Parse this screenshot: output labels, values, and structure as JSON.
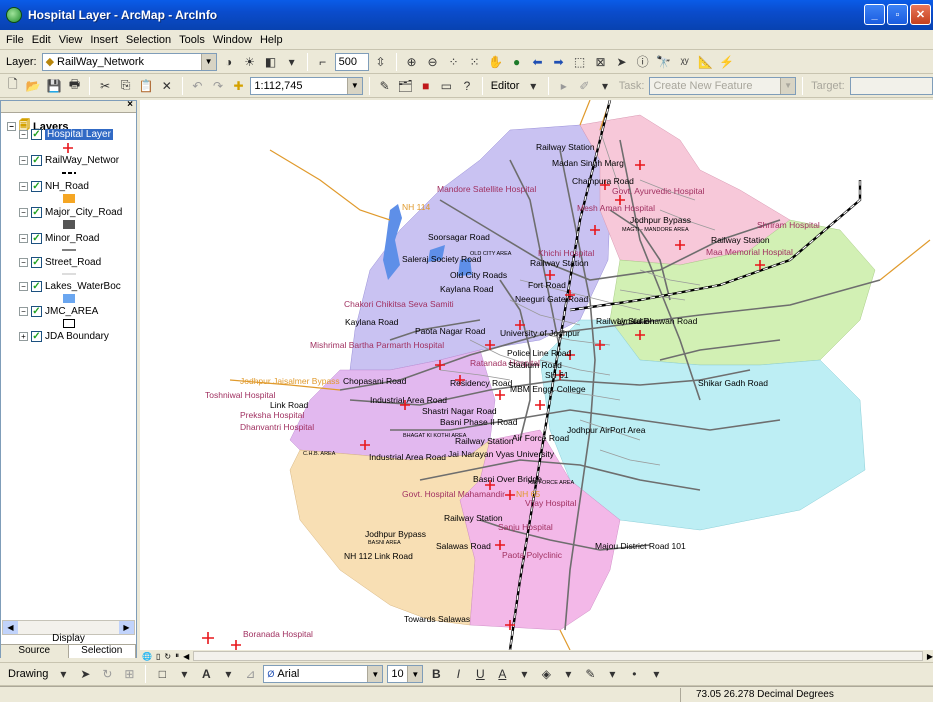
{
  "window": {
    "title": "Hospital Layer - ArcMap - ArcInfo"
  },
  "menu": [
    "File",
    "Edit",
    "View",
    "Insert",
    "Selection",
    "Tools",
    "Window",
    "Help"
  ],
  "toolbar1": {
    "layer_label": "Layer:",
    "layer_value": "RailWay_Network",
    "buffer_value": "500"
  },
  "toolbar2": {
    "scale_value": "1:112,745",
    "editor_label": "Editor",
    "task_label": "Task:",
    "task_value": "Create New Feature",
    "target_label": "Target:"
  },
  "toc": {
    "root_label": "Layers",
    "layers": [
      {
        "name": "Hospital Layer",
        "checked": true,
        "selected": true
      },
      {
        "name": "RailWay_Networ",
        "checked": true
      },
      {
        "name": "NH_Road",
        "checked": true
      },
      {
        "name": "Major_City_Road",
        "checked": true
      },
      {
        "name": "Minor_Road",
        "checked": true
      },
      {
        "name": "Street_Road",
        "checked": true
      },
      {
        "name": "Lakes_WaterBoc",
        "checked": true
      },
      {
        "name": "JMC_AREA",
        "checked": true
      },
      {
        "name": "JDA Boundary",
        "checked": true
      }
    ],
    "display_label": "Display",
    "tabs": [
      "Source",
      "Selection"
    ]
  },
  "map": {
    "labels": [
      "Railway Station",
      "Madan Singh Marg",
      "Chainpura Road",
      "Govt. Ayurvedic Hospital",
      "Mandore Satellite Hospital",
      "Mesh Aman Hospital",
      "NH 114",
      "Jodhpur Bypass",
      "MAGTI - MANDORE AREA",
      "Shriram Hospital",
      "Railway Station",
      "Maa Memorial Hospital",
      "Soorsagar Road",
      "Saleraj Society Road",
      "OLD CITY AREA",
      "Khichi Hospital",
      "Railway Station",
      "Old City Roads",
      "Kaylana Road",
      "Fort Road",
      "Chakori Chikitsa Seva Samiti",
      "Neeguri Gate Road",
      "Umaid Bhawan Road",
      "Kaylana Road",
      "Railway Station",
      "Paota Nagar Road",
      "University of Jodhpur",
      "Mishrimal Bartha Parmarth Hospital",
      "Police Line Road",
      "Ratanada Hospital",
      "Stadium Road",
      "Shikar Gadh Road",
      "Jodhpur Jaisalmer Bypass",
      "Chopasani Road",
      "SH 61",
      "Toshniwal Hospital",
      "Link Road",
      "MBM Engg. College",
      "Industrial Area Road",
      "Preksha Hospital",
      "Shastri Nagar Road",
      "Residency Road",
      "Dhanvantri Hospital",
      "Basni Phase II Road",
      "BHAGAT KI KOTHI AREA",
      "Jodhpur AirPort Area",
      "Railway Station",
      "Air Force Road",
      "C.H.B. AREA",
      "Industrial Area Road",
      "Jai Narayan Vyas University",
      "Basni Over Bridge",
      "AIR FORCE AREA",
      "Govt. Hospital Mahamandir",
      "NH 65",
      "Vijay Hospital",
      "Railway Station",
      "Sanju Hospital",
      "Jodhpur Bypass",
      "BASNI AREA",
      "NH 112 Link Road",
      "Salawas Road",
      "Paota Polyclinic",
      "Majou District Road 101",
      "Towards Salawas",
      "Boranada Hospital"
    ]
  },
  "drawing_toolbar": {
    "drawing_label": "Drawing",
    "font_value": "Arial",
    "size_value": "10"
  },
  "status": {
    "coords": "73.05  26.278 Decimal Degrees"
  }
}
